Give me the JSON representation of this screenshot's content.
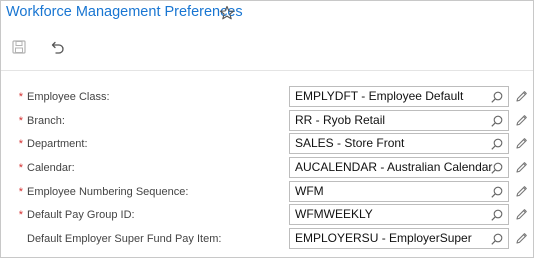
{
  "header": {
    "title": "Workforce Management Preferences",
    "favorite_icon": "star-icon"
  },
  "toolbar": {
    "save_icon": "save-icon",
    "undo_icon": "undo-icon"
  },
  "form": {
    "fields": [
      {
        "label": "Employee Class:",
        "required": true,
        "value": "EMPLYDFT - Employee Default"
      },
      {
        "label": "Branch:",
        "required": true,
        "value": "RR - Ryob Retail"
      },
      {
        "label": "Department:",
        "required": true,
        "value": "SALES - Store Front"
      },
      {
        "label": "Calendar:",
        "required": true,
        "value": "AUCALENDAR - Australian Calendar"
      },
      {
        "label": "Employee Numbering Sequence:",
        "required": true,
        "value": "WFM"
      },
      {
        "label": "Default Pay Group ID:",
        "required": true,
        "value": "WFMWEEKLY"
      },
      {
        "label": "Default Employer Super Fund Pay Item:",
        "required": false,
        "value": "EMPLOYERSU - EmployerSuper"
      }
    ],
    "required_marker": "*"
  },
  "colors": {
    "title": "#1976d2",
    "required": "#d32f2f",
    "border": "#bdbdbd"
  }
}
